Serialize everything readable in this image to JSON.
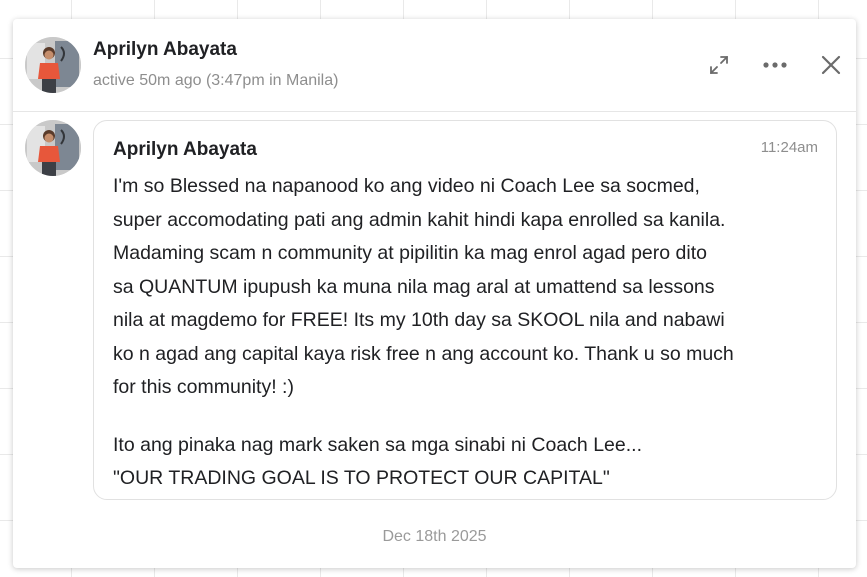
{
  "header": {
    "name": "Aprilyn Abayata",
    "status": "active 50m ago (3:47pm in Manila)",
    "expand_icon": "expand-icon",
    "more_icon": "more-horizontal-icon",
    "close_icon": "close-icon"
  },
  "message": {
    "sender": "Aprilyn Abayata",
    "time": "11:24am",
    "lines": [
      "I'm so Blessed na napanood ko ang video ni Coach Lee sa socmed,",
      "super accomodating pati ang admin kahit hindi kapa enrolled sa kanila.",
      "Madaming scam n community at pipilitin ka mag enrol agad pero dito",
      "sa QUANTUM ipupush ka muna nila mag aral at umattend sa lessons",
      "nila at magdemo for FREE! Its my 10th day sa SKOOL nila and nabawi",
      "ko n agad ang capital kaya risk free n ang account ko. Thank u so much",
      "for this community! :)",
      "Ito ang pinaka nag mark saken sa mga sinabi ni Coach Lee...",
      "\"OUR TRADING GOAL IS TO PROTECT OUR CAPITAL\""
    ]
  },
  "date_divider": "Dec 18th 2025"
}
